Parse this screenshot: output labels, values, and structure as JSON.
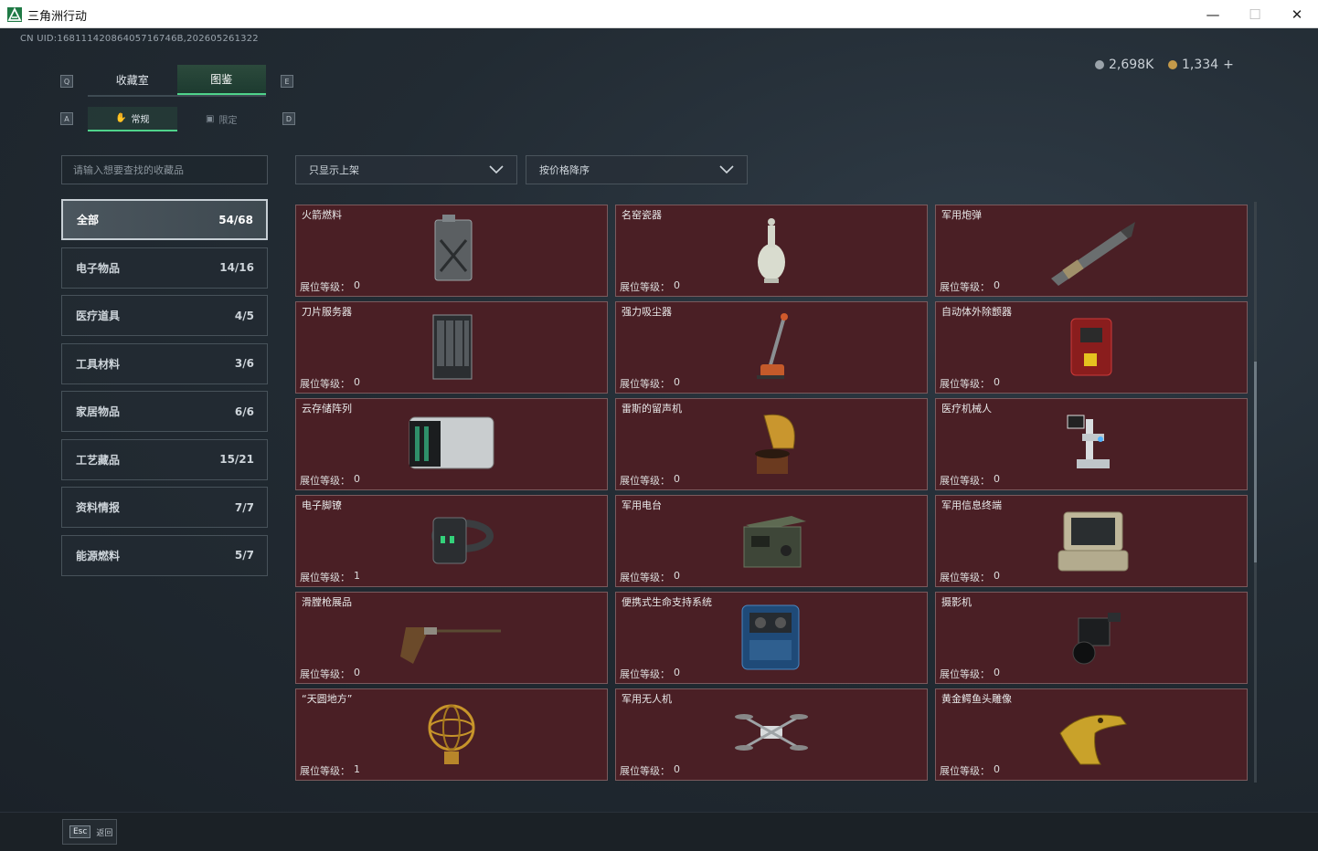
{
  "window": {
    "title": "三角洲行动",
    "minimize_icon": "—",
    "maximize_icon": "☐",
    "close_icon": "✕"
  },
  "header": {
    "uid": "CN UID:16811142086405716746B,202605261322",
    "currency_1": "2,698K",
    "currency_2": "1,334",
    "add_label": "+"
  },
  "keys": {
    "q": "Q",
    "e": "E",
    "a": "A",
    "d": "D"
  },
  "tabs": [
    {
      "label": "收藏室",
      "active": false
    },
    {
      "label": "图鉴",
      "active": true
    }
  ],
  "subtabs": [
    {
      "label": "常规",
      "icon": "✋",
      "active": true
    },
    {
      "label": "限定",
      "icon": "▣",
      "active": false
    }
  ],
  "search": {
    "placeholder": "请输入想要查找的收藏品"
  },
  "filters": {
    "show_filter": "只显示上架",
    "sort": "按价格降序"
  },
  "categories": [
    {
      "label": "全部",
      "count": "54/68",
      "active": true
    },
    {
      "label": "电子物品",
      "count": "14/16"
    },
    {
      "label": "医疗道具",
      "count": "4/5"
    },
    {
      "label": "工具材料",
      "count": "3/6"
    },
    {
      "label": "家居物品",
      "count": "6/6"
    },
    {
      "label": "工艺藏品",
      "count": "15/21"
    },
    {
      "label": "资料情报",
      "count": "7/7"
    },
    {
      "label": "能源燃料",
      "count": "5/7"
    }
  ],
  "level_label": "展位等级：",
  "items": [
    {
      "name": "火箭燃料",
      "level": "0",
      "icon": "jerrycan-icon"
    },
    {
      "name": "名窑瓷器",
      "level": "0",
      "icon": "vase-icon"
    },
    {
      "name": "军用炮弹",
      "level": "0",
      "icon": "shell-icon"
    },
    {
      "name": "刀片服务器",
      "level": "0",
      "icon": "server-icon"
    },
    {
      "name": "强力吸尘器",
      "level": "0",
      "icon": "vacuum-icon"
    },
    {
      "name": "自动体外除颤器",
      "level": "0",
      "icon": "defibrillator-icon"
    },
    {
      "name": "云存储阵列",
      "level": "0",
      "icon": "storage-array-icon"
    },
    {
      "name": "雷斯的留声机",
      "level": "0",
      "icon": "gramophone-icon"
    },
    {
      "name": "医疗机械人",
      "level": "0",
      "icon": "medical-robot-icon"
    },
    {
      "name": "电子脚镣",
      "level": "1",
      "icon": "ankle-monitor-icon"
    },
    {
      "name": "军用电台",
      "level": "0",
      "icon": "radio-icon"
    },
    {
      "name": "军用信息终端",
      "level": "0",
      "icon": "terminal-icon"
    },
    {
      "name": "滑膛枪展品",
      "level": "0",
      "icon": "musket-icon"
    },
    {
      "name": "便携式生命支持系统",
      "level": "0",
      "icon": "life-support-icon"
    },
    {
      "name": "摄影机",
      "level": "0",
      "icon": "camera-icon"
    },
    {
      "name": "“天圆地方”",
      "level": "1",
      "icon": "armillary-icon"
    },
    {
      "name": "军用无人机",
      "level": "0",
      "icon": "drone-icon"
    },
    {
      "name": "黄金鳄鱼头雕像",
      "level": "0",
      "icon": "crocodile-statue-icon"
    }
  ],
  "footer": {
    "esc_key": "Esc",
    "back_label": "返回"
  }
}
